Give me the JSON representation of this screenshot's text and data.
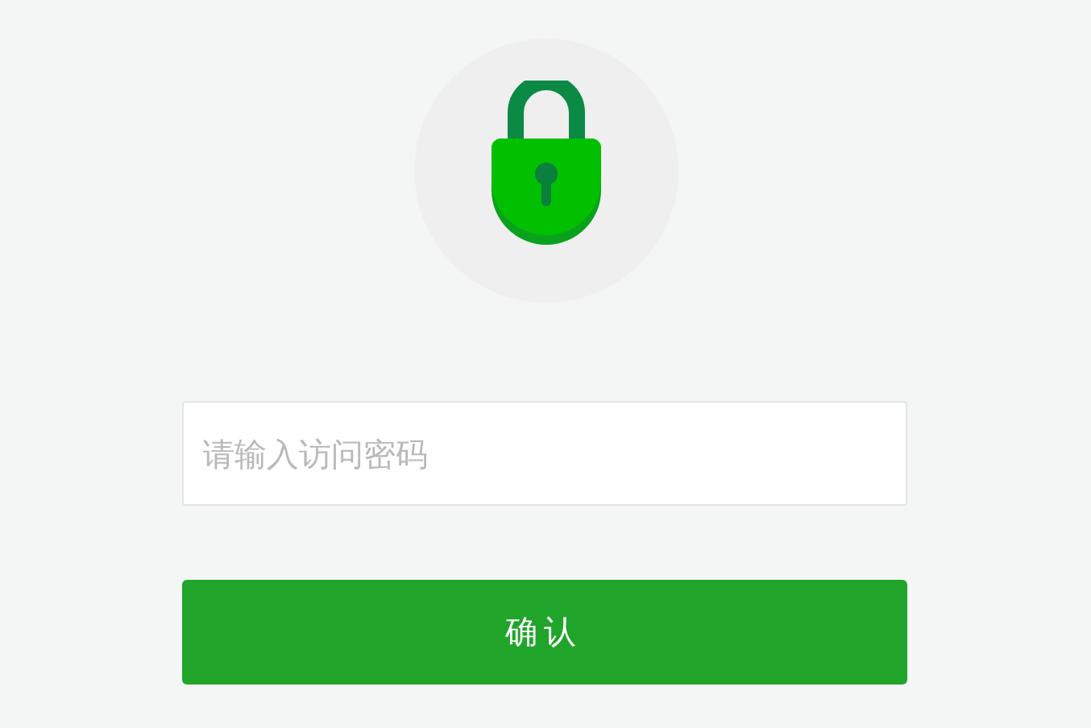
{
  "password_field": {
    "placeholder": "请输入访问密码"
  },
  "confirm_button": {
    "label": "确认"
  }
}
